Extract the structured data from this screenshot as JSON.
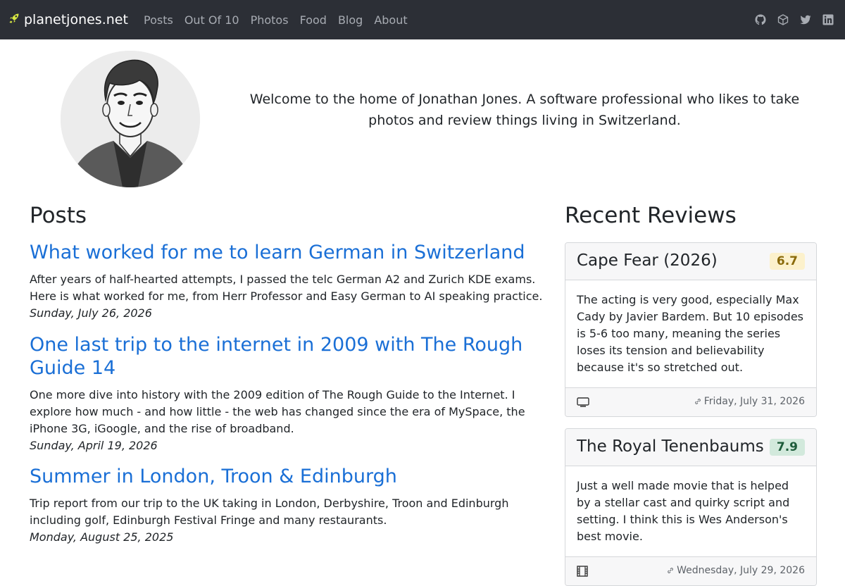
{
  "site": {
    "brand": "planetjones.net"
  },
  "nav": {
    "items": [
      "Posts",
      "Out Of 10",
      "Photos",
      "Food",
      "Blog",
      "About"
    ]
  },
  "social": [
    "github-icon",
    "cube-icon",
    "twitter-icon",
    "linkedin-icon"
  ],
  "intro": {
    "text": "Welcome to the home of Jonathan Jones. A software professional who likes to take photos and review things living in Switzerland."
  },
  "posts": {
    "heading": "Posts",
    "items": [
      {
        "title": "What worked for me to learn German in Switzerland",
        "excerpt": "After years of half-hearted attempts, I passed the telc German A2 and Zurich KDE exams. Here is what worked for me, from Herr Professor and Easy German to AI speaking practice.",
        "date": "Sunday, July 26, 2026"
      },
      {
        "title": "One last trip to the internet in 2009 with The Rough Guide 14",
        "excerpt": "One more dive into history with the 2009 edition of The Rough Guide to the Internet. I explore how much - and how little - the web has changed since the era of MySpace, the iPhone 3G, iGoogle, and the rise of broadband.",
        "date": "Sunday, April 19, 2026"
      },
      {
        "title": "Summer in London, Troon & Edinburgh",
        "excerpt": "Trip report from our trip to the UK taking in London, Derbyshire, Troon and Edinburgh including golf, Edinburgh Festival Fringe and many restaurants.",
        "date": "Monday, August 25, 2025"
      }
    ]
  },
  "reviews": {
    "heading": "Recent Reviews",
    "items": [
      {
        "title": "Cape Fear (2026)",
        "score": "6.7",
        "score_bg": "#fcf1cc",
        "score_fg": "#8a6a0a",
        "body": "The acting is very good, especially Max Cady by Javier Bardem. But 10 episodes is 5-6 too many, meaning the series loses its tension and believability because it's so stretched out.",
        "media_icon": "tv-icon",
        "date": "Friday, July 31, 2026"
      },
      {
        "title": "The Royal Tenenbaums",
        "score": "7.9",
        "score_bg": "#d2e9dc",
        "score_fg": "#1d5b3a",
        "body": "Just a well made movie that is helped by a stellar cast and quirky script and setting. I think this is Wes Anderson's best movie.",
        "media_icon": "film-icon",
        "date": "Wednesday, July 29, 2026"
      }
    ]
  },
  "colors": {
    "navbar": "#2c2f36",
    "link": "#1a6fd6"
  }
}
